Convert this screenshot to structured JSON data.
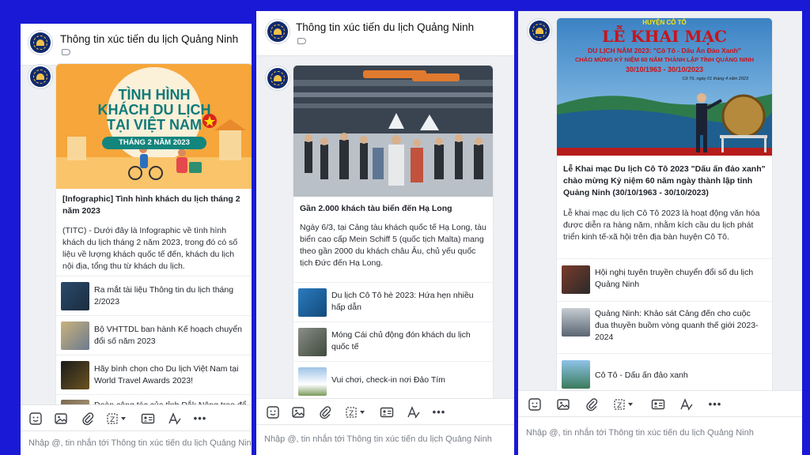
{
  "panel1": {
    "title": "Thông tin xúc tiến du lịch Quảng Ninh",
    "hero_text": {
      "line1": "TÌNH HÌNH",
      "line2": "KHÁCH DU LỊCH",
      "line3": "TẠI VIỆT NAM",
      "ribbon": "THÁNG 2 NĂM 2023"
    },
    "headline": "[Infographic] Tình hình khách du lịch tháng 2 năm 2023",
    "summary": "(TITC) - Dưới đây là Infographic về tình hình khách du lịch tháng 2 năm 2023, trong đó có số liệu về lượng khách quốc tế đến, khách du lịch nội địa, tổng thu từ khách du lịch.",
    "related": [
      "Ra mắt tài liệu Thông tin du lịch tháng 2/2023",
      "Bộ VHTTDL ban hành Kế hoạch chuyển đổi số năm 2023",
      "Hãy bình chọn cho Du lịch Việt Nam tại World Travel Awards 2023!",
      "Đoàn công tác của tỉnh Đắk Nông trao đổi"
    ],
    "placeholder": "Nhập @, tin nhắn tới Thông tin xúc tiến du lịch Quảng Ninh"
  },
  "panel2": {
    "title": "Thông tin xúc tiến du lịch Quảng Ninh",
    "headline": "Gần 2.000 khách tàu biển đến Hạ Long",
    "summary": "Ngày 6/3, tại Cảng tàu khách quốc tế Hạ Long, tàu biển cao cấp Mein Schiff 5 (quốc tịch Malta) mang theo gần 2000 du khách châu Âu, chủ yếu quốc tịch Đức đến Hạ Long.",
    "related": [
      "Du lịch Cô Tô hè 2023: Hứa hẹn nhiều hấp dẫn",
      "Móng Cái chủ động đón khách du lịch quốc tế",
      "Vui chơi, check-in nơi Đảo Tím"
    ],
    "placeholder": "Nhập @, tin nhắn tới Thông tin xúc tiến du lịch Quảng Ninh"
  },
  "panel3": {
    "hero_text": {
      "district": "HUYỆN CÔ TÔ",
      "main": "LỄ KHAI MẠC",
      "line1": "DU LỊCH NĂM 2023: \"Cô Tô - Dấu Ấn Đảo Xanh\"",
      "line2": "CHÀO MỪNG KỶ NIỆM 60 NĂM THÀNH LẬP TỈNH QUẢNG NINH",
      "dates": "30/10/1963 - 30/10/2023",
      "place": "Cô Tô, ngày 01 tháng 4 năm 2023"
    },
    "headline": "Lễ Khai mạc Du lịch Cô Tô 2023 \"Dấu ấn đảo xanh\" chào mừng Kỷ niệm 60 năm ngày thành lập tỉnh Quảng Ninh (30/10/1963 - 30/10/2023)",
    "summary": "Lễ khai mạc du lịch Cô Tô 2023 là hoạt động văn hóa được diễn ra hàng năm, nhằm kích cầu du lịch phát triển kinh tế-xã hội trên địa bàn huyện Cô Tô.",
    "related": [
      "Hội nghị tuyên truyền chuyển đổi số du lịch Quảng Ninh",
      "Quảng Ninh: Khảo sát Cảng đến cho cuộc đua thuyền buồm vòng quanh thế giới 2023-2024",
      "Cô Tô - Dấu ấn đảo xanh"
    ],
    "placeholder": "Nhập @, tin nhắn tới Thông tin xúc tiến du lịch Quảng Ninh"
  },
  "toolbar": {
    "icons": [
      "sticker-icon",
      "image-icon",
      "attach-icon",
      "screenshot-icon",
      "contact-card-icon",
      "text-format-icon",
      "more-icon"
    ],
    "more_label": "•••"
  },
  "colors": {
    "background": "#1a1ad6",
    "panel": "#eef0f3",
    "hero_orange": "#f6a63a",
    "hero_title": "#0f7a7a",
    "banner_red": "#c8141b"
  }
}
